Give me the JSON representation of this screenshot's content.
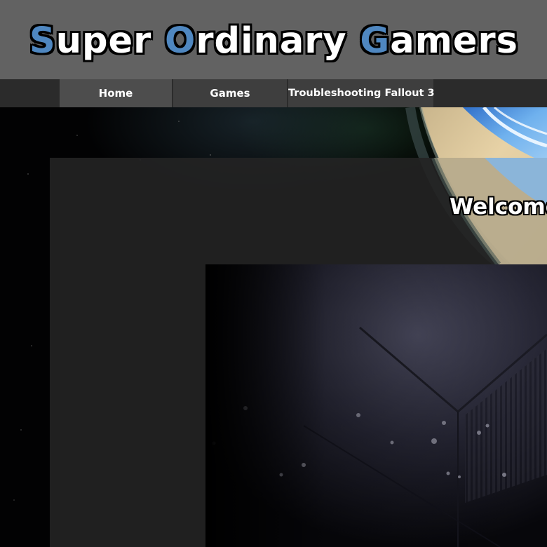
{
  "header": {
    "title_parts": [
      {
        "text": "S",
        "accent": true
      },
      {
        "text": "uper ",
        "accent": false
      },
      {
        "text": "O",
        "accent": true
      },
      {
        "text": "rdinary ",
        "accent": false
      },
      {
        "text": "G",
        "accent": true
      },
      {
        "text": "amers",
        "accent": false
      }
    ]
  },
  "nav": {
    "items": [
      {
        "label": "Home"
      },
      {
        "label": "Games"
      },
      {
        "label": "Troubleshooting Fallout 3"
      }
    ]
  },
  "main": {
    "welcome": "Welcome"
  },
  "colors": {
    "header_bg": "#626262",
    "title_accent": "#4f87c0",
    "nav_bg": "#2b2b2b",
    "nav_active": "#4d4d4d",
    "nav_item": "#3e3e3e",
    "panel_bg": "#242424"
  }
}
